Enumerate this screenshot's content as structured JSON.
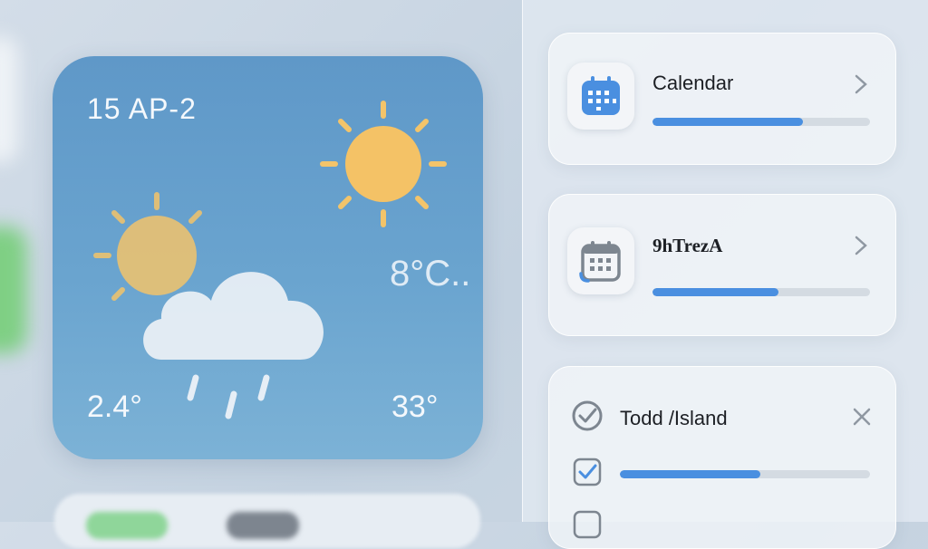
{
  "weather_widget": {
    "date": "15 AP-2",
    "temperature": "8°C..",
    "low": "2.4°",
    "high": "33°"
  },
  "cards": {
    "calendar": {
      "title": "Calendar",
      "icon": "calendar-icon",
      "progress": 0.69
    },
    "second": {
      "title": "9hTrezA",
      "icon": "calendar-icon",
      "progress": 0.58
    },
    "todo": {
      "title": "Todd /Island",
      "icon": "checkmark-circle-icon",
      "item_progress": 0.56
    }
  },
  "colors": {
    "accent": "#4a8fe0",
    "weather_bg": "#6aa4cf",
    "sun": "#f3c46a"
  }
}
